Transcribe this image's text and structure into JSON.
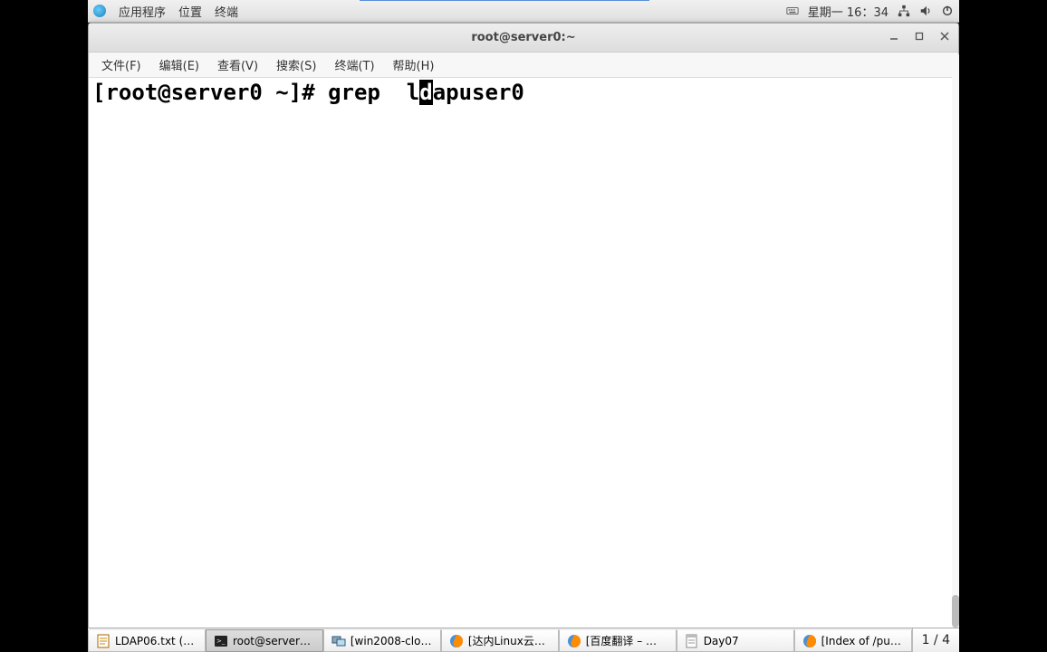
{
  "top_panel": {
    "applications": "应用程序",
    "places": "位置",
    "terminal": "终端",
    "datetime": "星期一 16：34"
  },
  "window": {
    "title": "root@server0:~",
    "menu": {
      "file": "文件(F)",
      "edit": "编辑(E)",
      "view": "查看(V)",
      "search": "搜索(S)",
      "terminal": "终端(T)",
      "help": "帮助(H)"
    },
    "terminal": {
      "prompt": "[root@server0 ~]# ",
      "command_pre": "grep  l",
      "cursor_char": "d",
      "command_post": "apuser0"
    }
  },
  "taskbar": {
    "items": [
      {
        "label": "LDAP06.txt (/…"
      },
      {
        "label": "root@server0:~"
      },
      {
        "label": "[win2008-clo…"
      },
      {
        "label": "[达内Linux云…"
      },
      {
        "label": "[百度翻译 – …"
      },
      {
        "label": "Day07"
      },
      {
        "label": "[Index of /pub…"
      }
    ],
    "page_indicator": "1 / 4"
  }
}
